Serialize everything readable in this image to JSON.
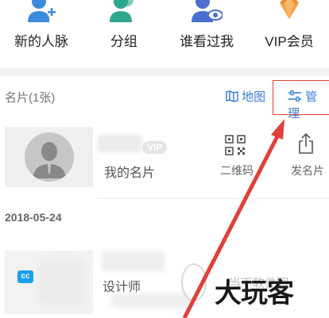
{
  "nav": {
    "items": [
      {
        "label": "新的人脉",
        "icon": "add-user-icon",
        "color": "#3a8be0"
      },
      {
        "label": "分组",
        "icon": "group-icon",
        "color": "#2fa68f"
      },
      {
        "label": "谁看过我",
        "icon": "user-view-icon",
        "color": "#4a6fd0"
      },
      {
        "label": "VIP会员",
        "icon": "diamond-icon",
        "color": "#f08a2a"
      }
    ]
  },
  "section": {
    "title": "名片(1张)",
    "map_label": "地图",
    "manage_label": "管理"
  },
  "my_card": {
    "vip_badge": "VIP",
    "label": "我的名片",
    "qr_label": "二维码",
    "share_label": "发名片"
  },
  "list": {
    "date": "2018-05-24",
    "card": {
      "logo_text": "cc",
      "title": "设计师",
      "company": "当下软件园"
    }
  },
  "watermark": {
    "text": "大玩客"
  },
  "colors": {
    "accent": "#3b7fd8",
    "annotation_red": "#e0403a"
  }
}
